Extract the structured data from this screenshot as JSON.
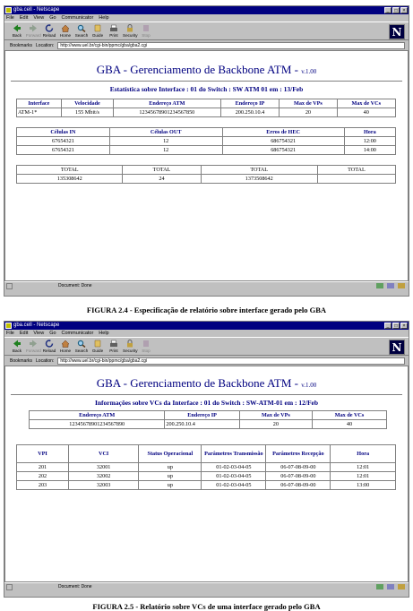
{
  "browser": {
    "title": "gba.cell - Netscape",
    "menu": [
      "File",
      "Edit",
      "View",
      "Go",
      "Communicator",
      "Help"
    ],
    "toolbar": [
      "Back",
      "Forward",
      "Reload",
      "Home",
      "Search",
      "Guide",
      "Print",
      "Security",
      "Stop"
    ],
    "bookmarks_label": "Bookmarks",
    "location_label": "Location:",
    "status": "Document: Done"
  },
  "window1": {
    "title": "gba.cell - Netscape",
    "url": "http://www.uel.br/cgi-bin/ppmc/gba/gba2.cgi",
    "page_title": "GBA - Gerenciamento de Backbone ATM - ",
    "version": "v.1.00",
    "subtitle": "Estatística sobre Interface  : 01 do Switch : SW ATM 01 em : 13/Feb",
    "table1": {
      "headers": [
        "Interface",
        "Velocidade",
        "Endereço ATM",
        "Endereço IP",
        "Max de VPs",
        "Max de VCs"
      ],
      "row": [
        "ATM-1*",
        "155 Mbit/s",
        "12345678901234567850",
        "200.250.10.4",
        "20",
        "40"
      ]
    },
    "table2": {
      "headers": [
        "Células IN",
        "Células OUT",
        "Erros de HEC",
        "Hora"
      ],
      "rows": [
        [
          "67654321",
          "12",
          "686754321",
          "12:00"
        ],
        [
          "67654321",
          "12",
          "686754321",
          "14:00"
        ]
      ]
    },
    "table3": {
      "headers": [
        "TOTAL",
        "TOTAL",
        "TOTAL",
        "TOTAL"
      ],
      "row": [
        "135308642",
        "24",
        "1373508642",
        ""
      ]
    }
  },
  "caption1": "FIGURA 2.4 - Especificação de relatório sobre interface gerado pelo GBA",
  "window2": {
    "title": "gba.cell - Netscape",
    "url": "http://www.uel.br/cgi-bin/ppmc/gba/gba2.cgi",
    "page_title": "GBA - Gerenciamento de Backbone ATM - ",
    "version": "v.1.00",
    "subtitle": "Informações sobre VCs da Interface : 01 do Switch : SW-ATM-01 em : 12/Feb",
    "table1": {
      "headers": [
        "Endereço ATM",
        "Endereço IP",
        "Max de VPs",
        "Max de VCs"
      ],
      "row": [
        "12345678901234567890",
        "200.250.10.4",
        "20",
        "40"
      ]
    },
    "table2": {
      "headers": [
        "VPI",
        "VCI",
        "Status Operacional",
        "Parâmetros Transmissão",
        "Parâmetros Recepção",
        "Hora"
      ],
      "rows": [
        [
          "201",
          "32001",
          "up",
          "01-02-03-04-05",
          "06-07-08-09-00",
          "12:01"
        ],
        [
          "202",
          "32002",
          "up",
          "01-02-03-04-05",
          "06-07-08-09-00",
          "12:01"
        ],
        [
          "203",
          "32003",
          "up",
          "01-02-03-04-05",
          "06-07-08-09-00",
          "13:00"
        ]
      ]
    }
  },
  "caption2": "FIGURA 2.5 - Relatório sobre VCs de uma interface gerado pelo GBA",
  "colors": {
    "heading": "#000080",
    "titlebar": "#000080",
    "chrome": "#c0c0c0"
  }
}
